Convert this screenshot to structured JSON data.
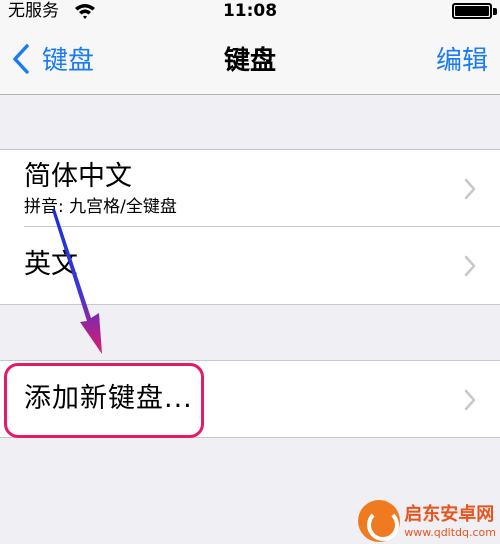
{
  "status_bar": {
    "carrier": "无服务",
    "time": "11:08",
    "wifi_icon": "wifi-icon",
    "battery_level": 1.0
  },
  "nav": {
    "back_label": "键盘",
    "title": "键盘",
    "edit_label": "编辑",
    "accent": "#1a7cf5"
  },
  "keyboards": [
    {
      "title": "简体中文",
      "subtitle": "拼音: 九宫格/全键盘"
    },
    {
      "title": "英文"
    }
  ],
  "add_keyboard": {
    "label": "添加新键盘..."
  },
  "annotation": {
    "color": "#e3196a"
  },
  "watermark": {
    "name": "启东安卓网",
    "url": "www.qdltdq.com",
    "color": "#e8541d"
  }
}
